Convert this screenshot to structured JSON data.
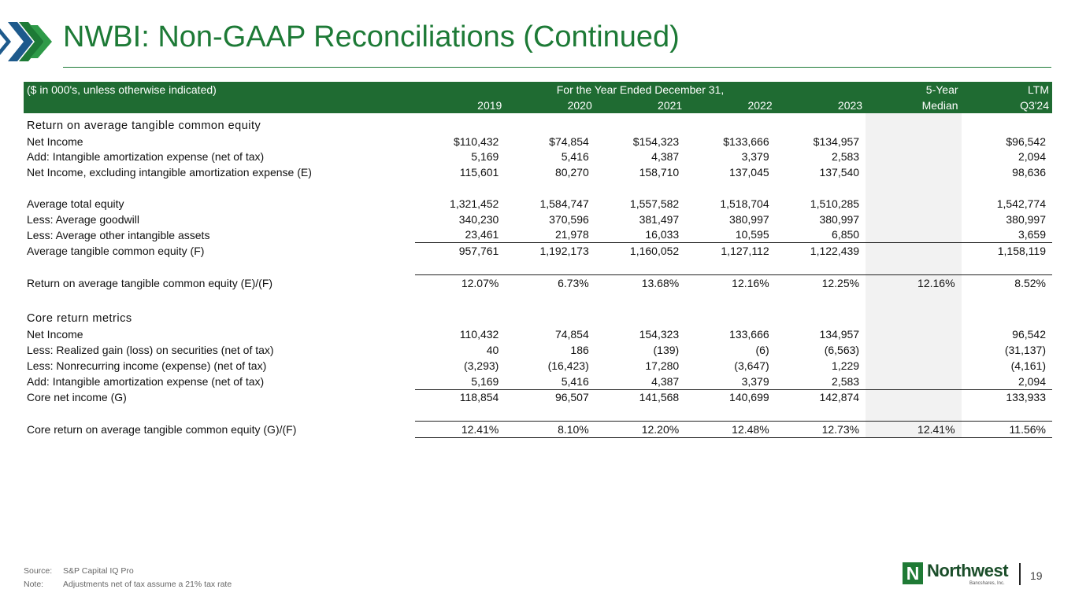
{
  "slide": {
    "title": "NWBI: Non-GAAP Reconciliations (Continued)",
    "page_number": "19"
  },
  "table": {
    "header": {
      "units_note": "($ in 000's, unless otherwise indicated)",
      "period_group": "For the Year Ended December 31,",
      "median_top": "5-Year",
      "ltm_top": "LTM",
      "years": [
        "2019",
        "2020",
        "2021",
        "2022",
        "2023"
      ],
      "median_bottom": "Median",
      "ltm_bottom": "Q3'24"
    },
    "rows": [
      {
        "type": "section",
        "label": "Return on average tangible common equity"
      },
      {
        "type": "data",
        "label": "Net Income",
        "values": [
          "$110,432",
          "$74,854",
          "$154,323",
          "$133,666",
          "$134,957"
        ],
        "median": "",
        "ltm": "$96,542"
      },
      {
        "type": "data",
        "label": "Add: Intangible amortization expense (net of tax)",
        "values": [
          "5,169",
          "5,416",
          "4,387",
          "3,379",
          "2,583"
        ],
        "median": "",
        "ltm": "2,094"
      },
      {
        "type": "data",
        "label": "Net Income, excluding intangible amortization expense (E)",
        "values": [
          "115,601",
          "80,270",
          "158,710",
          "137,045",
          "137,540"
        ],
        "median": "",
        "ltm": "98,636"
      },
      {
        "type": "gap"
      },
      {
        "type": "data",
        "label": "Average total equity",
        "values": [
          "1,321,452",
          "1,584,747",
          "1,557,582",
          "1,518,704",
          "1,510,285"
        ],
        "median": "",
        "ltm": "1,542,774"
      },
      {
        "type": "data",
        "label": "Less: Average goodwill",
        "values": [
          "340,230",
          "370,596",
          "381,497",
          "380,997",
          "380,997"
        ],
        "median": "",
        "ltm": "380,997"
      },
      {
        "type": "data",
        "label": "Less: Average other intangible assets",
        "values": [
          "23,461",
          "21,978",
          "16,033",
          "10,595",
          "6,850"
        ],
        "median": "",
        "ltm": "3,659",
        "underline": true
      },
      {
        "type": "data",
        "label": "Average tangible common equity (F)",
        "values": [
          "957,761",
          "1,192,173",
          "1,160,052",
          "1,127,112",
          "1,122,439"
        ],
        "median": "",
        "ltm": "1,158,119"
      },
      {
        "type": "gap"
      },
      {
        "type": "data",
        "label": "Return on average tangible common equity (E)/(F)",
        "values": [
          "12.07%",
          "6.73%",
          "13.68%",
          "12.16%",
          "12.25%"
        ],
        "median": "12.16%",
        "ltm": "8.52%",
        "overline": true
      },
      {
        "type": "gap"
      },
      {
        "type": "section",
        "label": "Core return metrics"
      },
      {
        "type": "data",
        "label": "Net Income",
        "values": [
          "110,432",
          "74,854",
          "154,323",
          "133,666",
          "134,957"
        ],
        "median": "",
        "ltm": "96,542"
      },
      {
        "type": "data",
        "label": "Less: Realized gain (loss) on securities (net of tax)",
        "values": [
          "40",
          "186",
          "(139)",
          "(6)",
          "(6,563)"
        ],
        "median": "",
        "ltm": "(31,137)"
      },
      {
        "type": "data",
        "label": "Less: Nonrecurring income (expense) (net of tax)",
        "values": [
          "(3,293)",
          "(16,423)",
          "17,280",
          "(3,647)",
          "1,229"
        ],
        "median": "",
        "ltm": "(4,161)"
      },
      {
        "type": "data",
        "label": "Add: Intangible amortization expense (net of tax)",
        "values": [
          "5,169",
          "5,416",
          "4,387",
          "3,379",
          "2,583"
        ],
        "median": "",
        "ltm": "2,094",
        "underline": true
      },
      {
        "type": "data",
        "label": "Core net income (G)",
        "values": [
          "118,854",
          "96,507",
          "141,568",
          "140,699",
          "142,874"
        ],
        "median": "",
        "ltm": "133,933"
      },
      {
        "type": "gap"
      },
      {
        "type": "data",
        "label": "Core return on average tangible common equity (G)/(F)",
        "values": [
          "12.41%",
          "8.10%",
          "12.20%",
          "12.48%",
          "12.73%"
        ],
        "median": "12.41%",
        "ltm": "11.56%",
        "overline": true,
        "underline": true
      }
    ]
  },
  "footnotes": [
    {
      "key": "Source:",
      "text": "S&P Capital IQ Pro"
    },
    {
      "key": "Note:",
      "text": "Adjustments net of tax assume a 21% tax rate"
    }
  ],
  "logo": {
    "mark": "N",
    "name": "Northwest",
    "subtitle": "Bancshares, Inc."
  },
  "colors": {
    "brand_green": "#1d7a36",
    "header_green": "#1f6b32",
    "chevron_blue": "#1e5a8c",
    "median_shade": "#f2f2f2"
  }
}
